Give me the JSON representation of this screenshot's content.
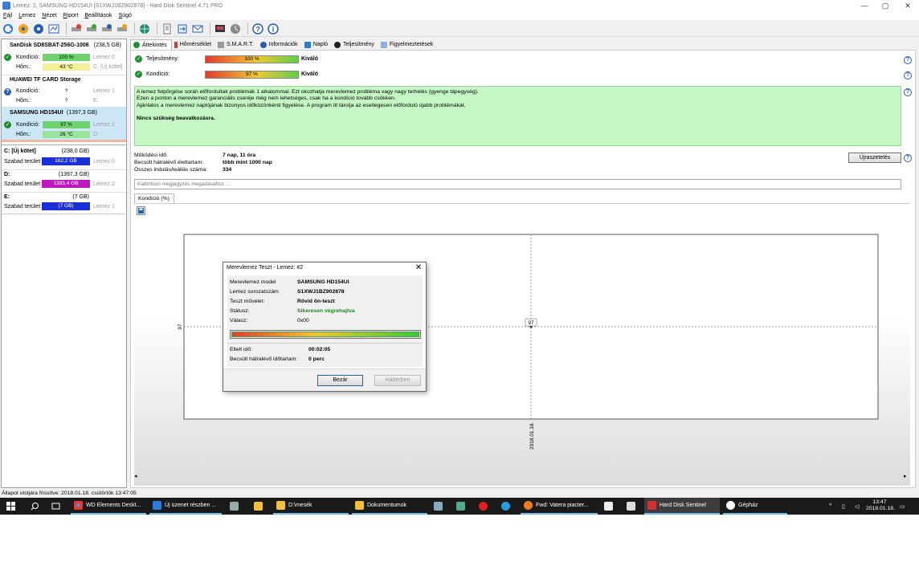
{
  "window": {
    "title": "Lemez: 2, SAMSUNG HD154UI [S1XWJ1BZ902878]  -  Hard Disk Sentinel 4.71 PRO",
    "controls": {
      "minimize": "—",
      "maximize": "▢",
      "close": "✕"
    }
  },
  "menu": [
    "Fájl",
    "Lemez",
    "Nézet",
    "Riport",
    "Beállítások",
    "Súgó"
  ],
  "toolbar": {
    "icons": [
      "refresh-icon",
      "disk-scan-icon",
      "disk-info-icon",
      "test-icon",
      "surface-test-icon",
      "short-test-icon",
      "extended-test-icon",
      "globe-icon",
      "report-icon",
      "send-report-icon",
      "email-report-icon",
      "print-icon",
      "schedule-icon",
      "help-icon",
      "about-icon"
    ]
  },
  "disks": [
    {
      "name": "SanDisk SD8SBAT-256G-1006",
      "size": "(238,5 GB)",
      "health_label": "Kondíció:",
      "health_value": "100 %",
      "health_pct": 100,
      "temp_label": "Hőm.:",
      "temp_value": "43 °C",
      "disk_ref": "Lemez 0",
      "drive_ref": "C: [Új kötet]",
      "status": "ok"
    },
    {
      "name": "HUAWEI  TF CARD Storage",
      "size": "",
      "health_label": "Kondíció:",
      "health_value": "?",
      "temp_label": "Hőm.:",
      "temp_value": "?",
      "disk_ref": "Lemez 1",
      "drive_ref": "E:",
      "status": "unknown"
    },
    {
      "name": "SAMSUNG HD154UI",
      "size": "(1397,3 GB)",
      "health_label": "Kondíció:",
      "health_value": "97 %",
      "health_pct": 97,
      "temp_label": "Hőm.:",
      "temp_value": "26 °C",
      "disk_ref": "Lemez 2",
      "drive_ref": "D:",
      "status": "ok"
    }
  ],
  "volumes": [
    {
      "name": "C: [Új kötet]",
      "size": "(238,0 GB)",
      "free_label": "Szabad terület",
      "free_value": "162,2 GB",
      "disk_ref": "Lemez 0",
      "color": "#1a2fd6"
    },
    {
      "name": "D:",
      "size": "(1397,3 GB)",
      "free_label": "Szabad terület",
      "free_value": "1393,4 GB",
      "disk_ref": "Lemez 2",
      "color": "#c018c0"
    },
    {
      "name": "E:",
      "size": "(7 GB)",
      "free_label": "Szabad terület",
      "free_value": "(7 GB)",
      "disk_ref": "Lemez 1",
      "color": "#1a2fd6"
    }
  ],
  "tabs": [
    "Áttekintés",
    "Hőmérséklet",
    "S.M.A.R.T.",
    "Információk",
    "Napló",
    "Teljesítmény",
    "Figyelmeztetések"
  ],
  "overview": {
    "performance_label": "Teljesítmény:",
    "performance_value": "100 %",
    "performance_text": "Kiváló",
    "health_label": "Kondíció:",
    "health_value": "97 %",
    "health_text": "Kiváló",
    "info_lines": [
      "A lemez felpörgése során előfordultak problémák 1 alkalommal. Ezt okozhatja merevlemez probléma vagy nagy terhelés (gyenge tápegység).",
      "Ezen a ponton a merevlemez garanciális cseréje még nem lehetséges, csak ha a kondíció tovább csökken.",
      "Ajánlatos a merevlemez naplójának bizonyos időközönkénti figyelése. A program itt tárolja az esetlegesen előforduló újabb problémákat."
    ],
    "info_bold": "Nincs szükség beavatkozásra.",
    "uptime_label": "Működési idő:",
    "uptime_value": "7 nap, 11 óra",
    "lifetime_label": "Becsült hátralévő élettartam:",
    "lifetime_value": "több mint 1000 nap",
    "starts_label": "Összes indulás/leállás száma:",
    "starts_value": "334",
    "reset_button": "Újraszetelés",
    "note_placeholder": "Kattintson megjegyzés megadásához ...",
    "subtab": "Kondíció  (%)"
  },
  "chart_data": {
    "type": "line",
    "x": [
      "2018.01.18."
    ],
    "series": [
      {
        "values": [
          97
        ]
      }
    ],
    "point_label": "97",
    "ylabel_tick": "97",
    "xlabel_tick": "2018.01.18."
  },
  "dialog": {
    "title": "Merevlemez Teszt - Lemez: #2",
    "rows": [
      {
        "k": "Merevlemez model",
        "v": "SAMSUNG HD154UI"
      },
      {
        "k": "Lemez sorozatszám",
        "v": "S1XWJ1BZ902878"
      },
      {
        "k": "Teszt művelet:",
        "v": "Rövid ön-teszt"
      },
      {
        "k": "Státusz:",
        "v": "Sikeresen végrehajtva"
      },
      {
        "k": "Válasz:",
        "v": "0x00"
      }
    ],
    "progress": 1.0,
    "elapsed_label": "Eltelt idő:",
    "elapsed_value": "00:02:05",
    "remaining_label": "Becsült hátralévő időtartam:",
    "remaining_value": "0 perc",
    "close_button": "Bezár",
    "background_button": "Háttérben",
    "status_color": "#1a8a1a"
  },
  "statusbar": "Állapot utoljára frissítve: 2018.01.18. csütörtök 13:47:05",
  "taskbar": {
    "items": [
      "WD Elements Deskt...",
      "Új üzenet részben ...",
      "D:\\mesék",
      "Dokumentumok",
      "Fwd: Vatera piacter...",
      "Hard Disk Sentinel",
      "Gépház"
    ],
    "time": "13:47",
    "date": "2018.01.18."
  }
}
